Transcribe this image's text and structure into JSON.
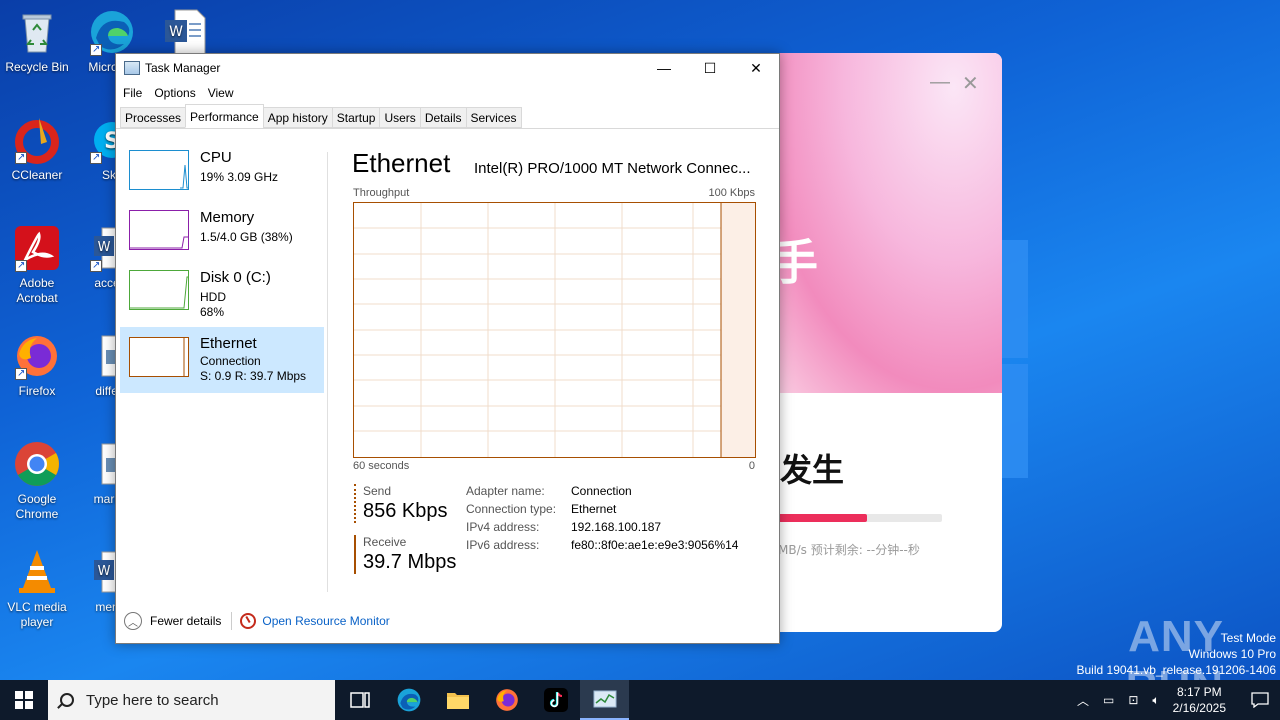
{
  "desktop": {
    "icons": [
      {
        "label": "Recycle Bin"
      },
      {
        "label": "Micro Ed"
      },
      {
        "label": "CCleaner"
      },
      {
        "label": "Sky"
      },
      {
        "label": "Adobe Acrobat"
      },
      {
        "label": "accept"
      },
      {
        "label": "Firefox"
      },
      {
        "label": "differe"
      },
      {
        "label": "Google Chrome"
      },
      {
        "label": "market"
      },
      {
        "label": "VLC media player"
      },
      {
        "label": "memb"
      }
    ]
  },
  "background_window": {
    "hero_text": "手",
    "title": "发生",
    "progress_fraction": 0.54,
    "speed_text": "MB/s 预计剩余: --分钟--秒",
    "progress_color": "#ec2e5b"
  },
  "watermark": {
    "brand": "ANY RUN",
    "line1": "Test Mode",
    "line2": "Windows 10 Pro",
    "line3": "Build 19041.vb_release.191206-1406"
  },
  "task_manager": {
    "title": "Task Manager",
    "menu": [
      "File",
      "Options",
      "View"
    ],
    "tabs": [
      "Processes",
      "Performance",
      "App history",
      "Startup",
      "Users",
      "Details",
      "Services"
    ],
    "active_tab": "Performance",
    "sidebar": [
      {
        "name": "CPU",
        "line1": "19%  3.09 GHz",
        "line2": "",
        "color": "#1c8ecf"
      },
      {
        "name": "Memory",
        "line1": "1.5/4.0 GB (38%)",
        "line2": "",
        "color": "#8b1fa9"
      },
      {
        "name": "Disk 0 (C:)",
        "line1": "HDD",
        "line2": "68%",
        "color": "#4da83a"
      },
      {
        "name": "Ethernet",
        "line1": "Connection",
        "line2": "S: 0.9  R: 39.7 Mbps",
        "color": "#a74f01"
      }
    ],
    "main": {
      "title": "Ethernet",
      "adapter": "Intel(R) PRO/1000 MT Network Connec...",
      "throughput_label": "Throughput",
      "max_label": "100 Kbps",
      "axis_left": "60 seconds",
      "axis_right": "0",
      "send_label": "Send",
      "send_value": "856 Kbps",
      "receive_label": "Receive",
      "receive_value": "39.7 Mbps",
      "properties": [
        {
          "key": "Adapter name:",
          "value": "Connection"
        },
        {
          "key": "Connection type:",
          "value": "Ethernet"
        },
        {
          "key": "IPv4 address:",
          "value": "192.168.100.187"
        },
        {
          "key": "IPv6 address:",
          "value": "fe80::8f0e:ae1e:e9e3:9056%14"
        }
      ]
    },
    "footer": {
      "fewer_details": "Fewer details",
      "open_resource_monitor": "Open Resource Monitor"
    },
    "accent_color": "#a74f01"
  },
  "taskbar": {
    "search_placeholder": "Type here to search",
    "time": "8:17 PM",
    "date": "2/16/2025"
  }
}
